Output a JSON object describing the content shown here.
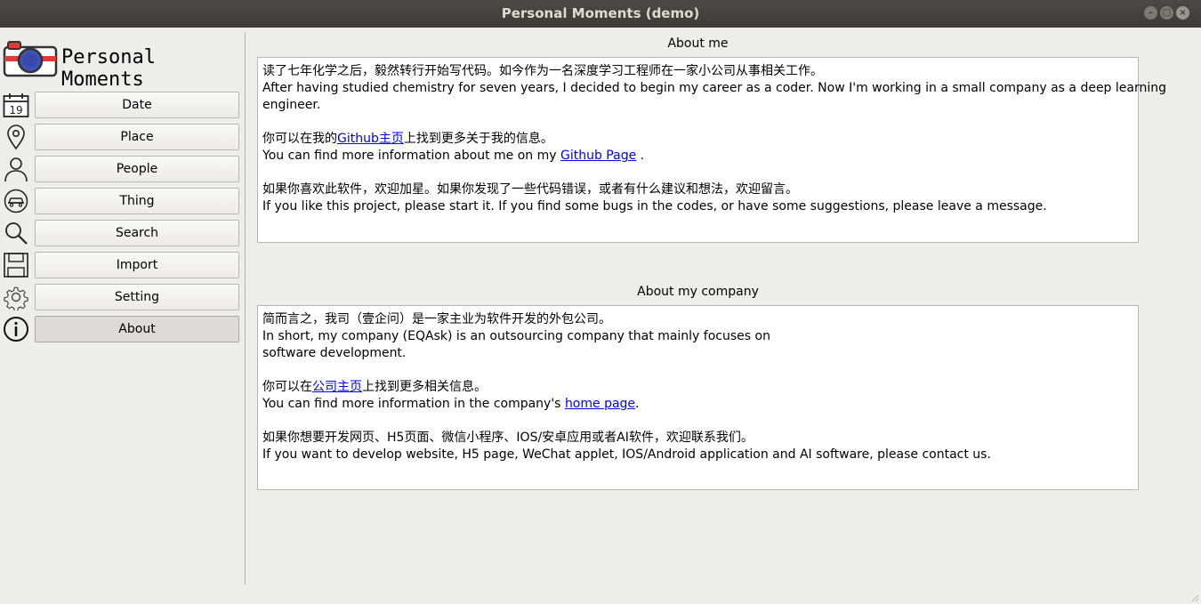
{
  "window": {
    "title": "Personal Moments (demo)",
    "controls": [
      "minimize",
      "maximize",
      "close"
    ],
    "control_glyphs": {
      "minimize": "–",
      "maximize": "□",
      "close": "×"
    }
  },
  "sidebar": {
    "app_name": "Personal Moments",
    "logo_icon": "camera-icon",
    "calendar_day": "19",
    "items": [
      {
        "label": "Date",
        "icon": "calendar-icon"
      },
      {
        "label": "Place",
        "icon": "map-pin-icon"
      },
      {
        "label": "People",
        "icon": "person-icon"
      },
      {
        "label": "Thing",
        "icon": "car-icon"
      },
      {
        "label": "Search",
        "icon": "search-icon"
      },
      {
        "label": "Import",
        "icon": "floppy-disk-icon"
      },
      {
        "label": "Setting",
        "icon": "gear-icon"
      },
      {
        "label": "About",
        "icon": "info-icon",
        "active": true
      }
    ]
  },
  "about_me": {
    "title": "About me",
    "line1_zh": "读了七年化学之后，毅然转行开始写代码。如今作为一名深度学习工程师在一家小公司从事相关工作。",
    "line1_en_a": "After having studied chemistry for seven years, I decided to begin my career as a coder. Now I'm working in a small company as a deep learning",
    "line1_en_b": "engineer.",
    "line2_zh_pre": "你可以在我的",
    "line2_zh_link": "Github主页",
    "line2_zh_post": "上找到更多关于我的信息。",
    "line2_en_pre": "You can find more information about me on my ",
    "line2_en_link": "Github Page",
    "line2_en_post": " .",
    "line3_zh": "如果你喜欢此软件，欢迎加星。如果你发现了一些代码错误，或者有什么建议和想法，欢迎留言。",
    "line3_en": "If you like this project, please start it. If you find some bugs in the codes, or have some suggestions, please leave a message."
  },
  "about_company": {
    "title": "About my company",
    "line1_zh": "简而言之，我司（壹企问）是一家主业为软件开发的外包公司。",
    "line1_en_a": "In short, my company (EQAsk) is an outsourcing company that mainly focuses on",
    "line1_en_b": "software development.",
    "line2_zh_pre": "你可以在",
    "line2_zh_link": "公司主页",
    "line2_zh_post": "上找到更多相关信息。",
    "line2_en_pre": "You can find more information in the company's ",
    "line2_en_link": "home page",
    "line2_en_post": ".",
    "line3_zh": "如果你想要开发网页、H5页面、微信小程序、IOS/安卓应用或者AI软件，欢迎联系我们。",
    "line3_en": "If you want to develop website, H5 page, WeChat applet, IOS/Android application and AI software, please contact us."
  }
}
